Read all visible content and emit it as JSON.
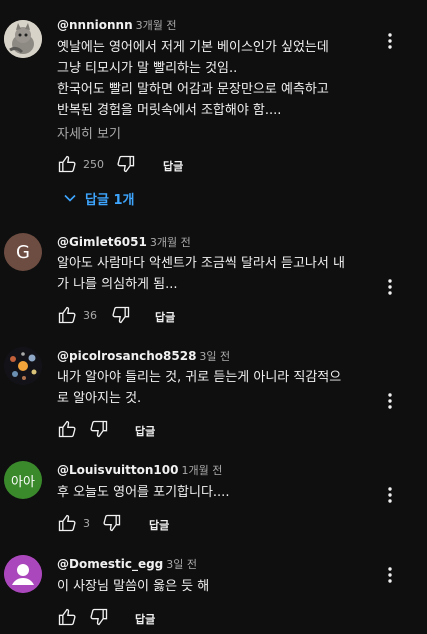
{
  "comments": [
    {
      "author": "@nnnionnn",
      "time": "3개월 전",
      "text": "옛날에는 영어에서 저게 기본 베이스인가 싶었는데\n그냥 티모시가 말 빨리하는 것임..\n한국어도 빨리 말하면 어감과 문장만으로 예측하고\n반복된 경험을 머릿속에서 조합해야 함....",
      "more_label": "자세히 보기",
      "likes": "250",
      "reply_label": "답글",
      "replies_label": "답글 1개",
      "avatar_icon": "cat-photo-avatar"
    },
    {
      "author": "@Gimlet6051",
      "time": "3개월 전",
      "text": "알아도 사람마다 악센트가 조금씩 달라서 듣고나서 내\n가 나를 의심하게 됨...",
      "likes": "36",
      "reply_label": "답글",
      "avatar_letter": "G"
    },
    {
      "author": "@picolrosancho8528",
      "time": "3일 전",
      "text": "내가 알아야 들리는 것, 귀로 듣는게 아니라 직감적으\n로 알아지는 것.",
      "likes": "",
      "reply_label": "답글",
      "avatar_icon": "planets-avatar"
    },
    {
      "author": "@Louisvuitton100",
      "time": "1개월 전",
      "text": "후 오늘도 영어를 포기합니다....",
      "likes": "3",
      "reply_label": "답글",
      "avatar_letter": "아아"
    },
    {
      "author": "@Domestic_egg",
      "time": "3일 전",
      "text": "이 사장님 말씀이 옳은 듯 해",
      "likes": "",
      "reply_label": "답글",
      "avatar_icon": "default-user-avatar"
    }
  ],
  "colors": {
    "background": "#0f0f0f",
    "text": "#f1f1f1",
    "secondary_text": "#aaaaaa",
    "link_blue": "#3ea6ff"
  }
}
